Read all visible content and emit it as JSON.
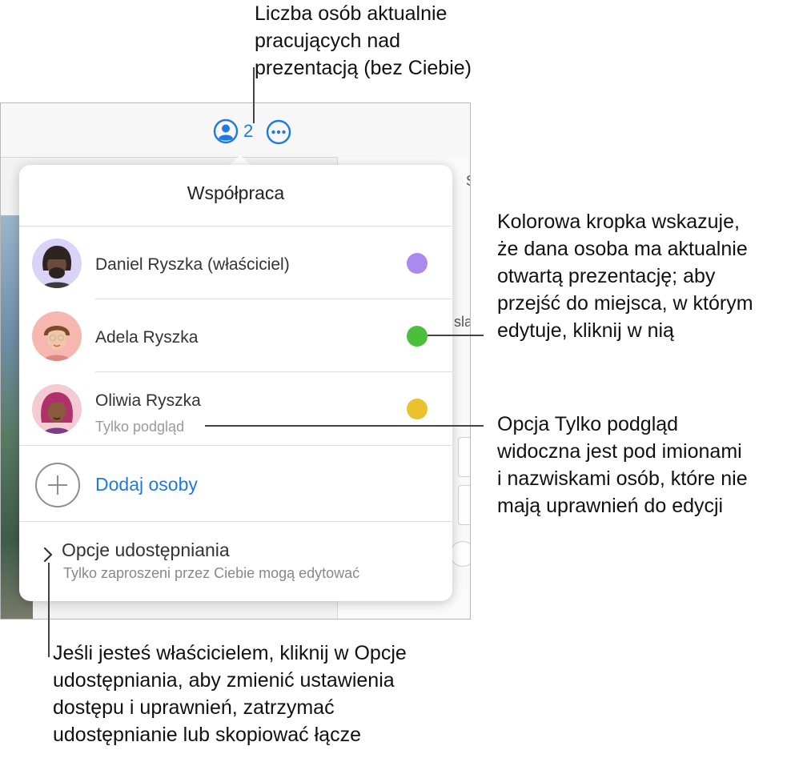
{
  "callouts": {
    "participants": "Liczba osób aktualnie\npracujących nad\nprezentacją (bez Ciebie)",
    "presence_dot": "Kolorowa kropka wskazuje,\nże dana osoba ma aktualnie\notwartą prezentację; aby\nprzejść do miejsca, w którym\nedytuje, kliknij w nią",
    "view_only": "Opcja Tylko podgląd\nwidoczna jest pod imionami\ni nazwiskami osób, które nie\nmają uprawnień do edycji",
    "sharing_options": "Jeśli jesteś właścicielem, kliknij w Opcje\nudostępniania, aby zmienić ustawienia\ndostępu i uprawnień, zatrzymać\nudostępnianie lub skopiować łącze"
  },
  "toolbar": {
    "collaborator_count": "2",
    "collab_icon": "person-circle-icon",
    "more_icon": "ellipsis-circle-icon"
  },
  "inspector": {
    "tab_fragment": "S",
    "field_fragment": "sla"
  },
  "popover": {
    "title": "Współpraca",
    "people": [
      {
        "name": "Daniel Ryszka (właściciel)",
        "subtitle": "",
        "dot_color": "#a98bf0"
      },
      {
        "name": "Adela Ryszka",
        "subtitle": "",
        "dot_color": "#4cbf3a"
      },
      {
        "name": "Oliwia Ryszka",
        "subtitle": "Tylko podgląd",
        "dot_color": "#ecc22c"
      }
    ],
    "add_people_label": "Dodaj osoby",
    "add_icon": "plus-circle-icon",
    "sharing_options": {
      "label": "Opcje udostępniania",
      "subtitle": "Tylko zaproszeni przez Ciebie mogą edytować",
      "icon": "chevron-right-icon"
    }
  },
  "colors": {
    "accent": "#1f7ae0",
    "leader_lines": "#444444"
  }
}
